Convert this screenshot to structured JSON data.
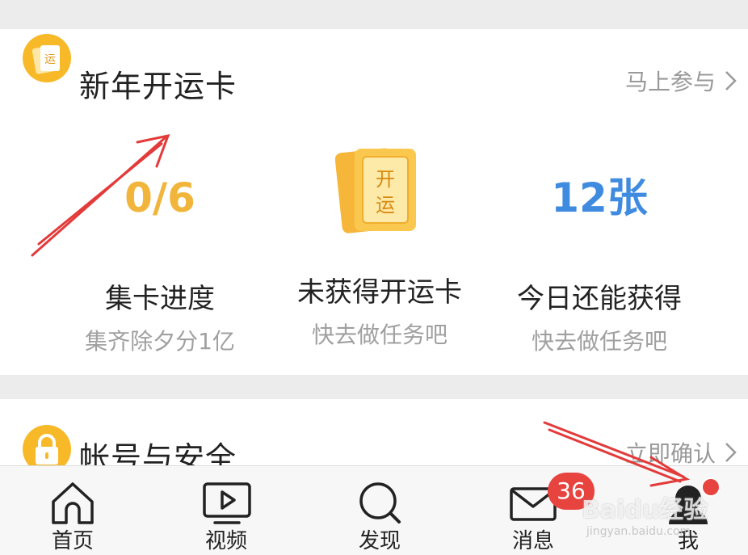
{
  "fortune_card": {
    "title": "新年开运卡",
    "link_label": "马上参与",
    "icon": "fortune-card-icon",
    "icon_text": "运",
    "illustration_text_top": "开",
    "illustration_text_bottom": "运",
    "stats": [
      {
        "value": "0/6",
        "label": "集卡进度",
        "sub": "集齐除夕分1亿",
        "color": "#f2b53c"
      },
      {
        "value": "",
        "label": "未获得开运卡",
        "sub": "快去做任务吧"
      },
      {
        "value": "12张",
        "label": "今日还能获得",
        "sub": "快去做任务吧",
        "color": "#3f8be0"
      }
    ]
  },
  "account_card": {
    "title": "帐号与安全",
    "link_label": "立即确认",
    "icon": "lock-icon"
  },
  "tabbar": {
    "tabs": [
      {
        "label": "首页",
        "icon": "home-icon"
      },
      {
        "label": "视频",
        "icon": "video-icon"
      },
      {
        "label": "发现",
        "icon": "search-icon"
      },
      {
        "label": "消息",
        "icon": "mail-icon",
        "badge": "36"
      },
      {
        "label": "我",
        "icon": "avatar-icon",
        "dot": true
      }
    ]
  },
  "watermark": {
    "text": "Baidu经验",
    "sub": "jingyan.baidu.com"
  },
  "colors": {
    "accent": "#f7b928",
    "badge": "#e8443f",
    "arrow": "#e33a3a"
  }
}
